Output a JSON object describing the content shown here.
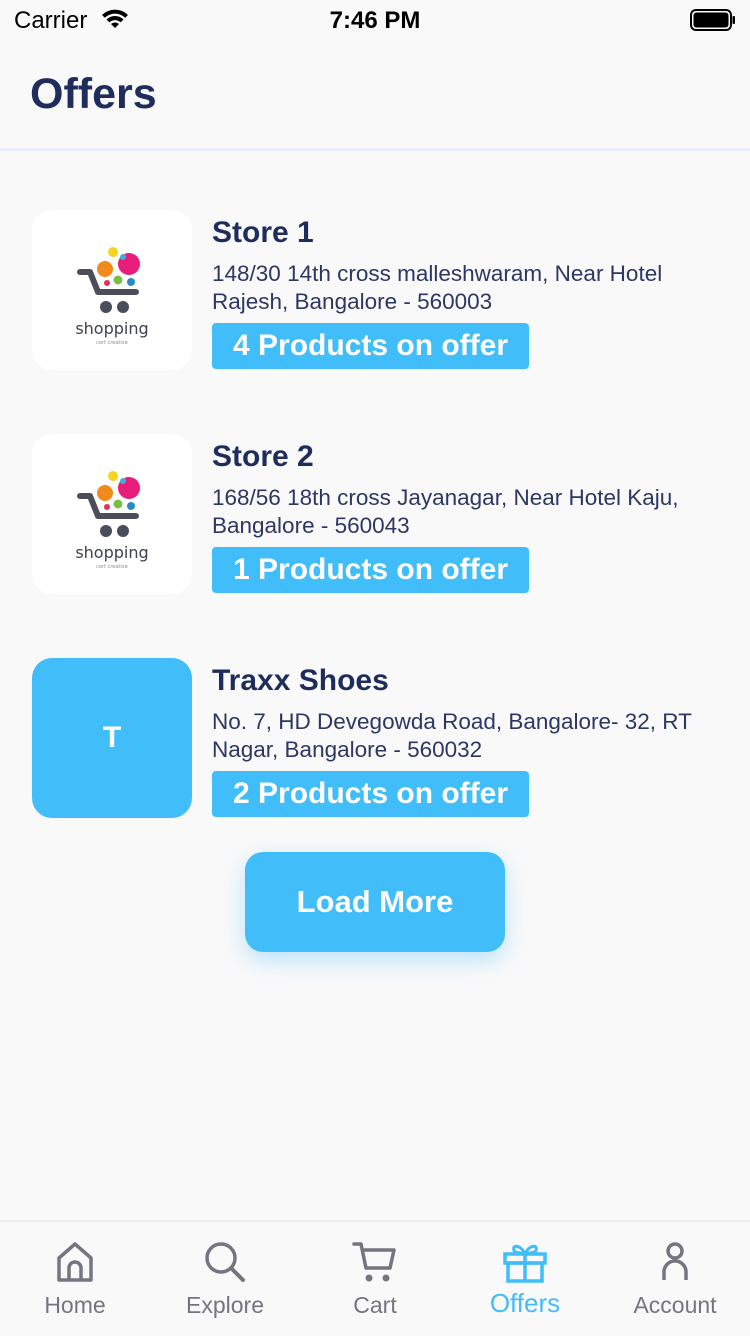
{
  "status_bar": {
    "carrier": "Carrier",
    "time": "7:46 PM"
  },
  "header": {
    "title": "Offers"
  },
  "stores": [
    {
      "name": "Store 1",
      "address": "148/30 14th cross malleshwaram, Near Hotel Rajesh, Bangalore - 560003",
      "offer_label": "4 Products on offer",
      "logo_type": "shopping-cart-logo",
      "logo_text": "shopping",
      "logo_subtext": "cart creative"
    },
    {
      "name": "Store 2",
      "address": "168/56 18th cross Jayanagar, Near Hotel Kaju, Bangalore - 560043",
      "offer_label": "1 Products on offer",
      "logo_type": "shopping-cart-logo",
      "logo_text": "shopping",
      "logo_subtext": "cart creative"
    },
    {
      "name": "Traxx Shoes",
      "address": "No. 7, HD Devegowda Road, Bangalore- 32, RT Nagar, Bangalore - 560032",
      "offer_label": "2 Products on offer",
      "logo_type": "letter",
      "logo_letter": "T"
    }
  ],
  "load_more_label": "Load More",
  "tabs": [
    {
      "label": "Home",
      "icon": "home-icon",
      "active": false
    },
    {
      "label": "Explore",
      "icon": "search-icon",
      "active": false
    },
    {
      "label": "Cart",
      "icon": "cart-icon",
      "active": false
    },
    {
      "label": "Offers",
      "icon": "gift-icon",
      "active": true
    },
    {
      "label": "Account",
      "icon": "user-icon",
      "active": false
    }
  ],
  "colors": {
    "accent": "#41bdf9",
    "title_text": "#1f2d5c",
    "inactive_tab": "#747580",
    "background": "#f9f9fa"
  }
}
